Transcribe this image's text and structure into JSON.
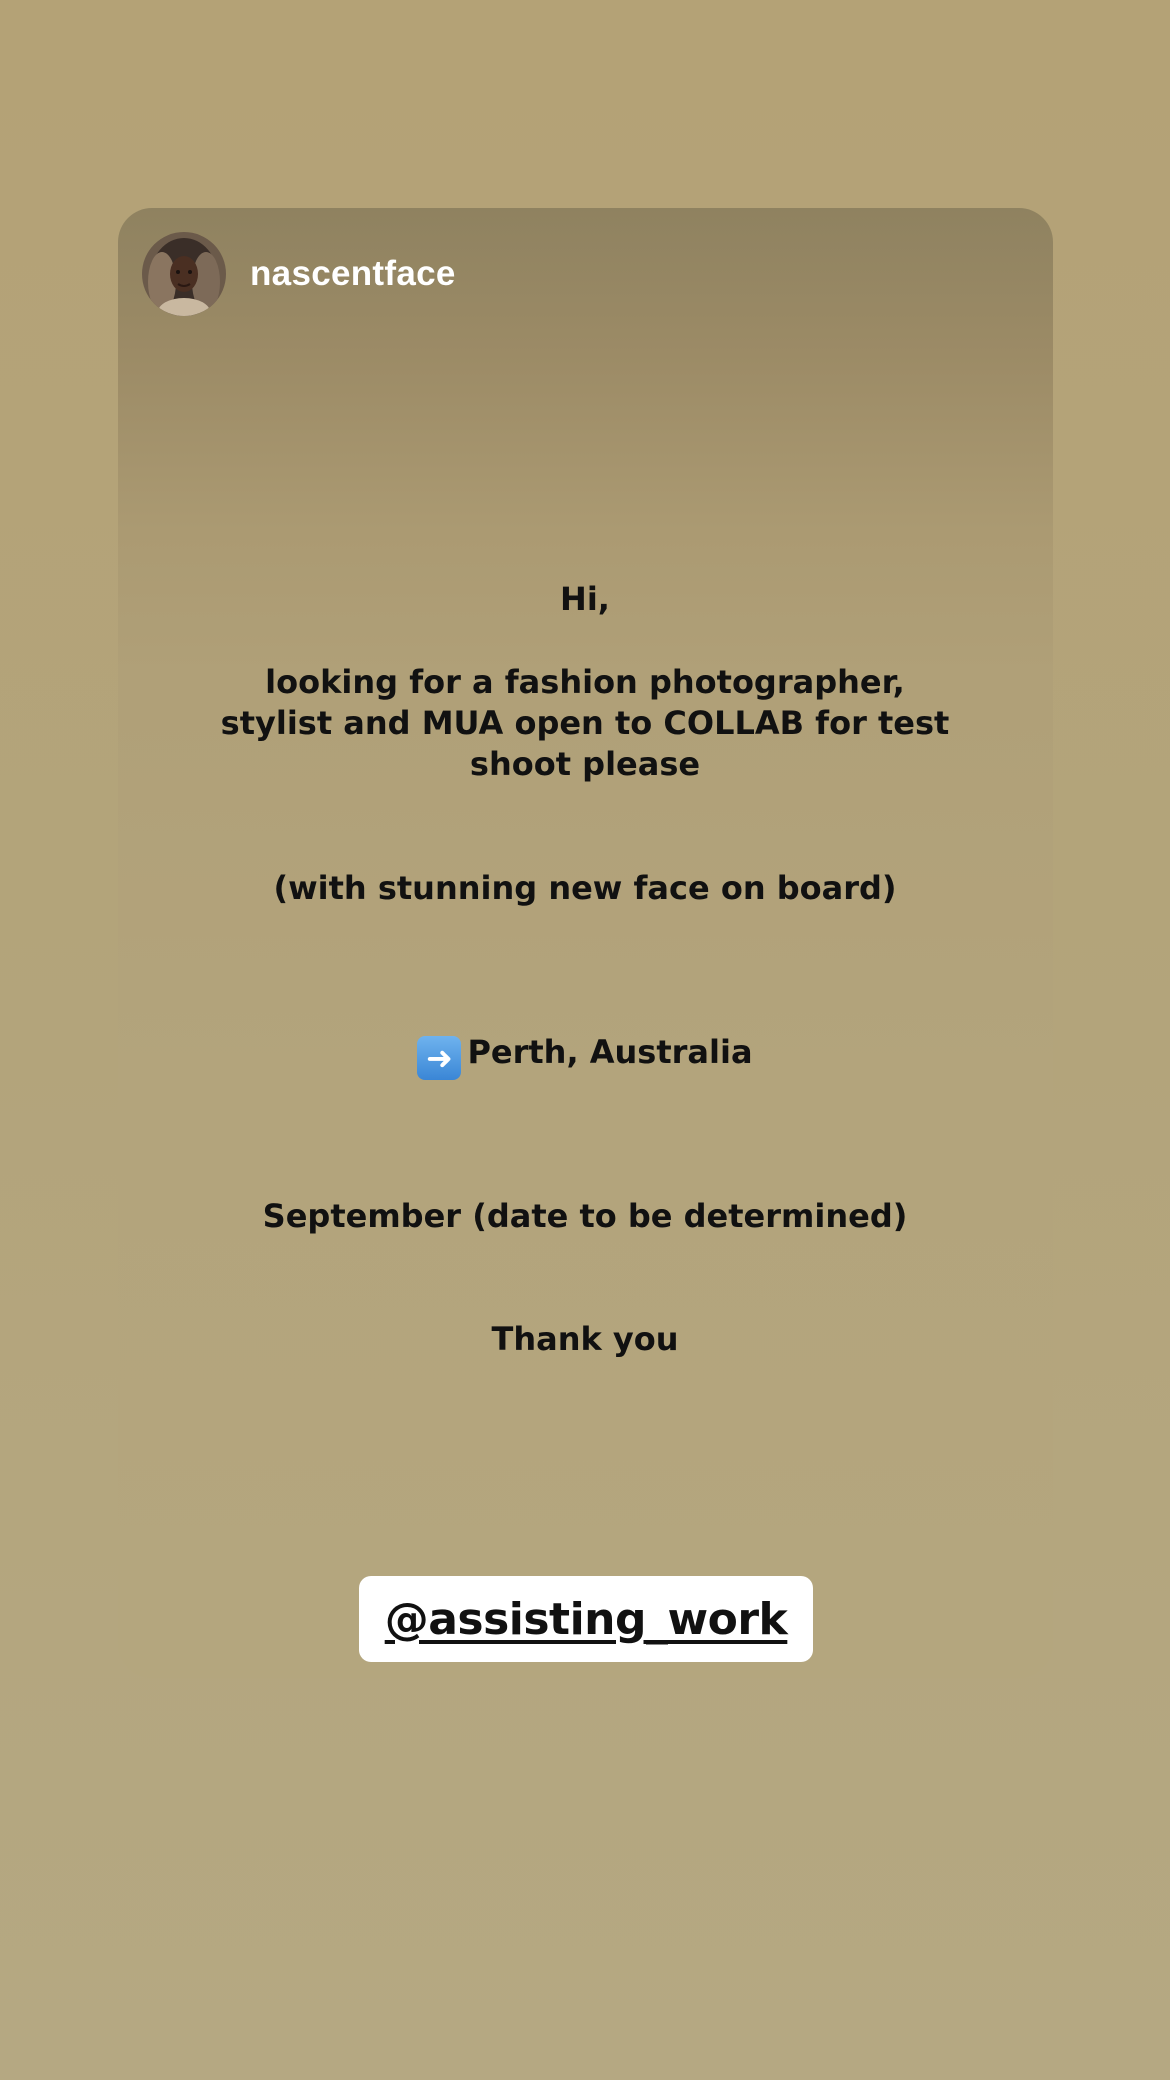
{
  "story": {
    "username": "nascentface",
    "avatar_icon": "profile-photo",
    "lines": {
      "greeting": "Hi,",
      "request_line1": "looking for a fashion photographer,",
      "request_line2": "stylist and MUA open to COLLAB for test",
      "request_line3": "shoot please",
      "note": "(with stunning new face on board)",
      "location_icon": "➡️",
      "location": "Perth, Australia",
      "date": "September (date to be determined)",
      "thanks": "Thank you"
    },
    "mention": {
      "text": "@assisting_work",
      "icon": "threads-at-icon"
    },
    "colors": {
      "background": "#b4a276",
      "text": "#111111",
      "username": "#ffffff",
      "sticker_bg": "#ffffff"
    }
  }
}
